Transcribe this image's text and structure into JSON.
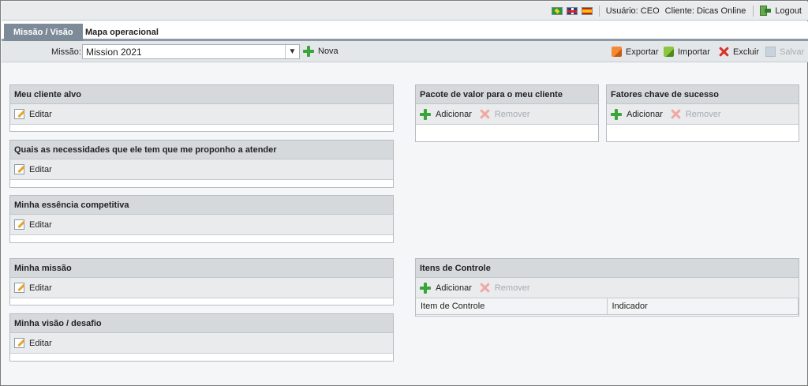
{
  "topbar": {
    "user_text": "Usuário: CEO",
    "client_text": "Cliente: Dicas Online",
    "logout_label": "Logout",
    "flags": [
      "brazil-flag-icon",
      "uk-flag-icon",
      "spain-flag-icon"
    ]
  },
  "tabs": [
    {
      "label": "Missão / Visão",
      "active": true
    },
    {
      "label": "Mapa operacional",
      "active": false
    }
  ],
  "toolbar": {
    "mission_label": "Missão:",
    "mission_value": "Mission 2021",
    "new_label": "Nova",
    "export_label": "Exportar",
    "import_label": "Importar",
    "delete_label": "Excluir",
    "save_label": "Salvar"
  },
  "panels": {
    "cliente_alvo": {
      "title": "Meu cliente alvo",
      "edit_label": "Editar"
    },
    "necessidades": {
      "title": "Quais as necessidades que ele tem que me proponho a atender",
      "edit_label": "Editar"
    },
    "essencia": {
      "title": "Minha essência competitiva",
      "edit_label": "Editar"
    },
    "missao": {
      "title": "Minha missão",
      "edit_label": "Editar"
    },
    "visao": {
      "title": "Minha visão / desafio",
      "edit_label": "Editar"
    },
    "pacote": {
      "title": "Pacote de valor para o meu cliente",
      "add_label": "Adicionar",
      "remove_label": "Remover"
    },
    "fatores": {
      "title": "Fatores chave de sucesso",
      "add_label": "Adicionar",
      "remove_label": "Remover"
    },
    "itens": {
      "title": "Itens de Controle",
      "add_label": "Adicionar",
      "remove_label": "Remover",
      "columns": [
        "Item de Controle",
        "Indicador"
      ]
    }
  },
  "colors": {
    "accent_tab": "#7d8b99",
    "add_green": "#3aa53a",
    "delete_red": "#d9332b"
  }
}
